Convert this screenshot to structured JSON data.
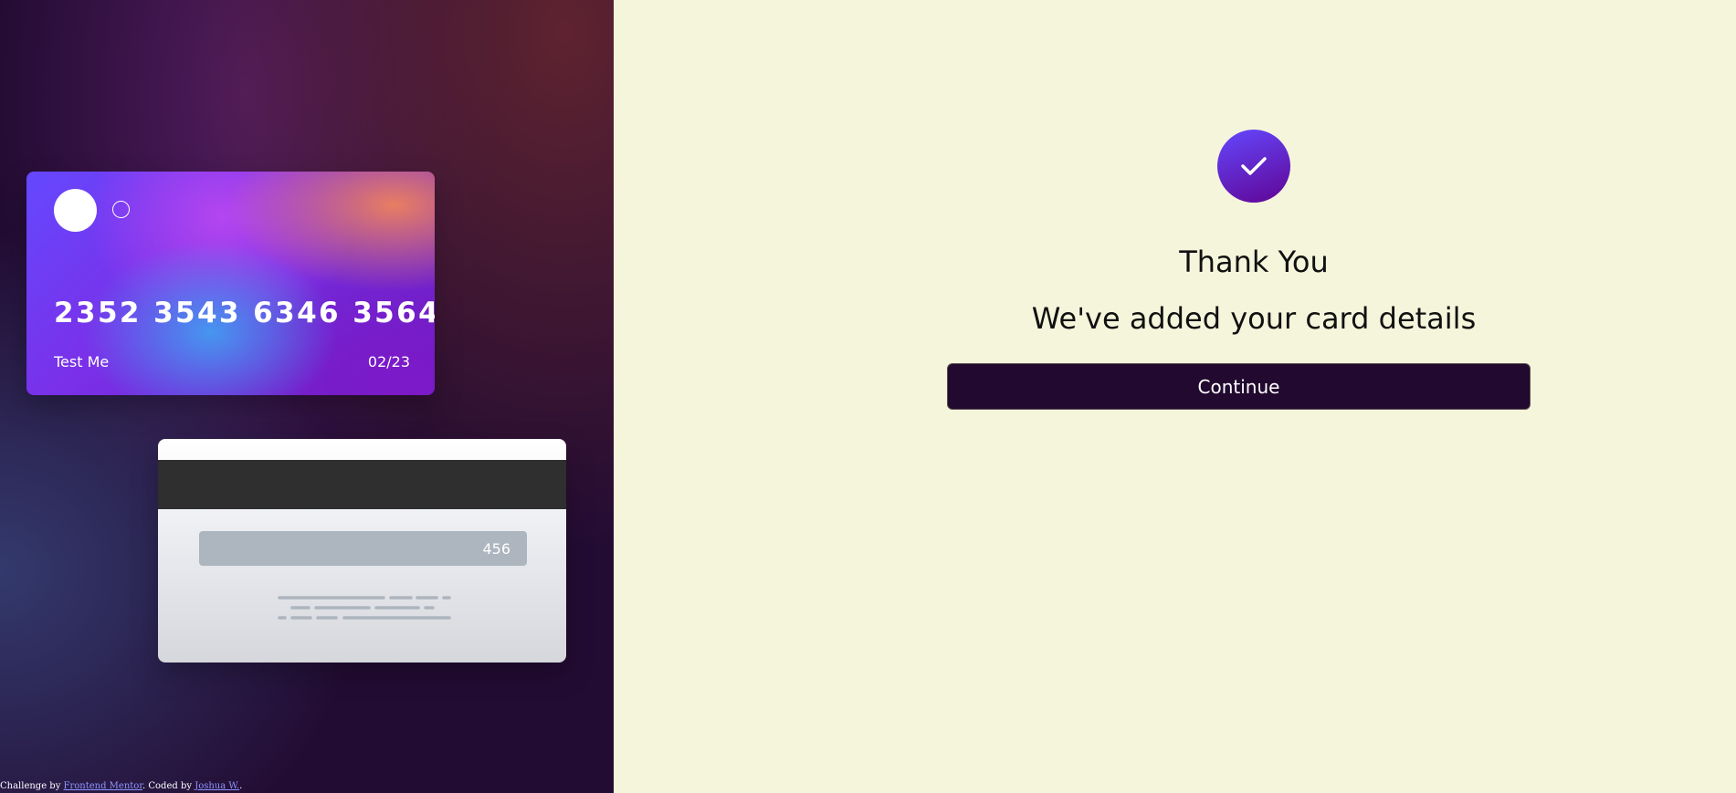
{
  "card_front": {
    "number": "2352 3543 6346 3564",
    "name": "Test Me",
    "expiry": "02/23"
  },
  "card_back": {
    "cvc": "456"
  },
  "attribution": {
    "prefix": "Challenge by ",
    "frontend_mentor_link": "Frontend Mentor",
    "middle": ". Coded by ",
    "author_link": "Joshua W.",
    "suffix": "."
  },
  "confirmation": {
    "icon": "check-icon",
    "title": "Thank You",
    "message": "We've added your card details",
    "continue_label": "Continue"
  },
  "colors": {
    "accent_start": "#6448fe",
    "accent_end": "#600594",
    "button_bg": "#21092f",
    "panel_bg": "#f5f5dc"
  }
}
